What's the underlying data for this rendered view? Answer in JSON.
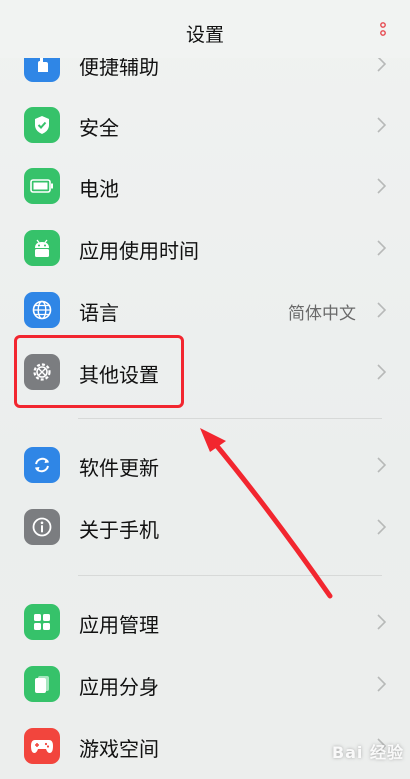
{
  "header": {
    "title": "设置",
    "more_icon": "more-vertical-icon"
  },
  "accent": "#e6484f",
  "rows": [
    {
      "label": "便捷辅助",
      "icon": "hand-icon",
      "color": "#2f86e6"
    },
    {
      "label": "安全",
      "icon": "shield-check-icon",
      "color": "#36c26a"
    },
    {
      "label": "电池",
      "icon": "battery-icon",
      "color": "#36c26a"
    },
    {
      "label": "应用使用时间",
      "icon": "android-icon",
      "color": "#36c26a"
    },
    {
      "label": "语言",
      "value": "简体中文",
      "icon": "globe-icon",
      "color": "#2f86e6"
    },
    {
      "label": "其他设置",
      "icon": "gear-icon",
      "color": "#7b7d80"
    },
    {
      "label": "软件更新",
      "icon": "refresh-icon",
      "color": "#2f86e6"
    },
    {
      "label": "关于手机",
      "icon": "info-icon",
      "color": "#7b7d80"
    },
    {
      "label": "应用管理",
      "icon": "grid-icon",
      "color": "#36c26a"
    },
    {
      "label": "应用分身",
      "icon": "clone-icon",
      "color": "#36c26a"
    },
    {
      "label": "游戏空间",
      "icon": "gamepad-icon",
      "color": "#f2453d"
    }
  ],
  "watermark": "Bai 经验"
}
